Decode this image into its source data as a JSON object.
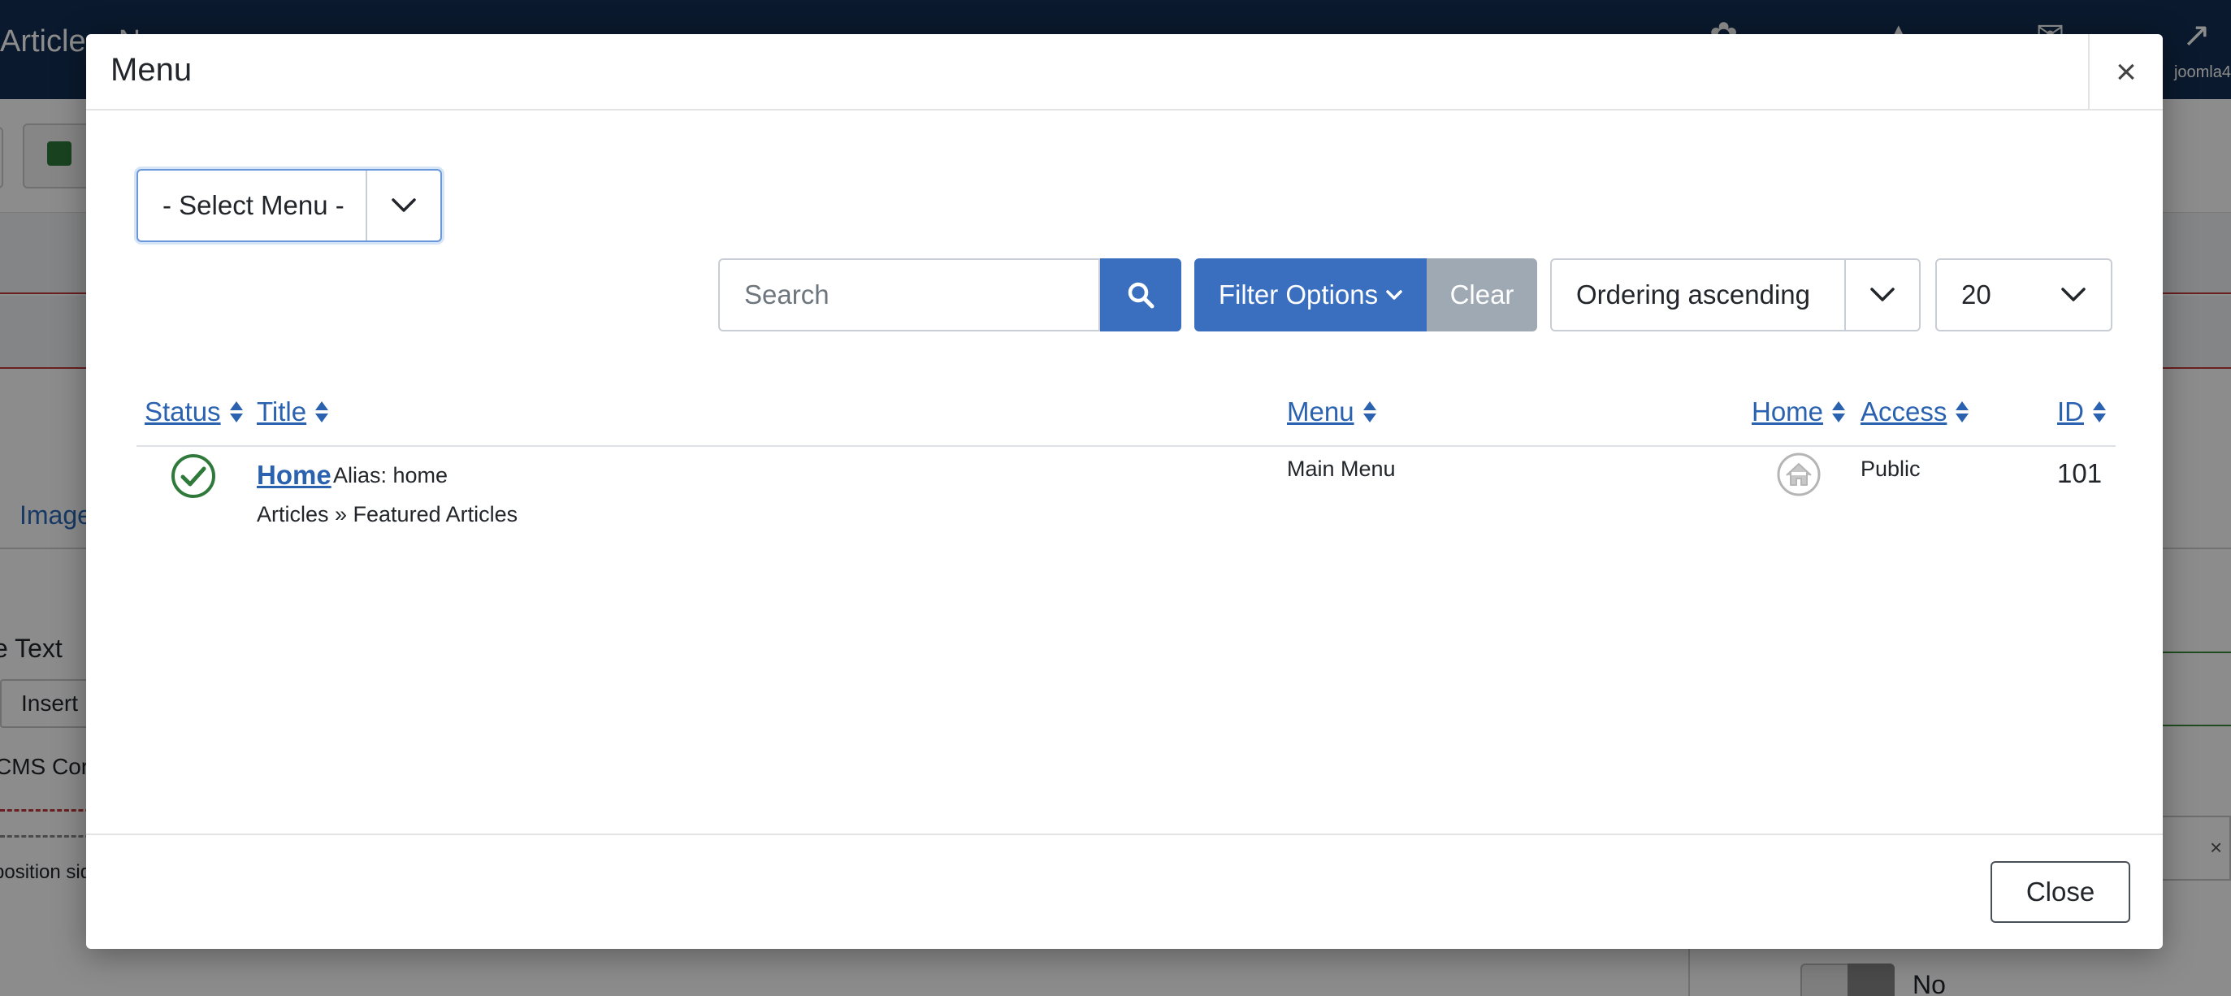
{
  "background": {
    "page_title": "Articles: N",
    "user_label": "joomla4",
    "tab_label": "Images",
    "field_label": "e Text",
    "insert_button": "Insert",
    "cms_text": "CMS Cor",
    "position_text": "position sid",
    "toggle_label": "No"
  },
  "modal": {
    "title": "Menu",
    "close_x": "×",
    "menu_select": {
      "value": "- Select Menu -"
    },
    "search": {
      "placeholder": "Search",
      "value": ""
    },
    "filter_options_label": "Filter Options",
    "clear_label": "Clear",
    "ordering_select": {
      "value": "Ordering ascending"
    },
    "limit_select": {
      "value": "20"
    },
    "columns": {
      "status": "Status",
      "title": "Title",
      "menu": "Menu",
      "home": "Home",
      "access": "Access",
      "id": "ID"
    },
    "rows": [
      {
        "status": "published",
        "title": "Home",
        "alias": "Alias: home",
        "path": "Articles » Featured Articles",
        "menu": "Main Menu",
        "home": "home-icon",
        "access": "Public",
        "id": "101"
      }
    ],
    "footer_close": "Close"
  },
  "colors": {
    "primary": "#3a6fc0",
    "link": "#2a62b0",
    "success": "#2f7a3b",
    "clear": "#9fa9b3",
    "header_bg": "#132f53"
  }
}
